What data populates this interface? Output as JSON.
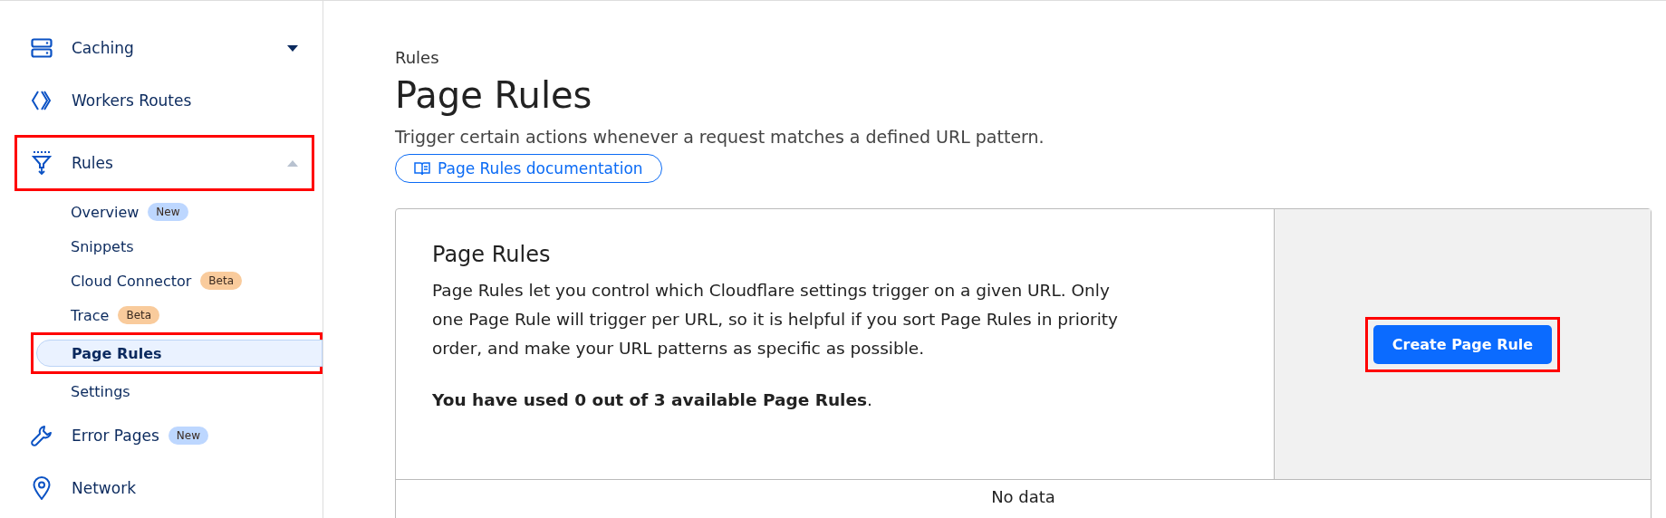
{
  "sidebar": {
    "items": [
      {
        "kind": "caching",
        "label": "Caching",
        "expanded": false,
        "highlighted": false
      },
      {
        "kind": "workers",
        "label": "Workers Routes",
        "highlighted": false
      },
      {
        "kind": "rules",
        "label": "Rules",
        "expanded": true,
        "highlighted": true,
        "children": [
          {
            "label": "Overview",
            "badge": {
              "text": "New",
              "color": "#bdd7ff"
            },
            "selected": false,
            "highlighted": false
          },
          {
            "label": "Snippets",
            "selected": false,
            "highlighted": false
          },
          {
            "label": "Cloud Connector",
            "badge": {
              "text": "Beta",
              "color": "#f9cb9c"
            },
            "selected": false,
            "highlighted": false
          },
          {
            "label": "Trace",
            "badge": {
              "text": "Beta",
              "color": "#f9cb9c"
            },
            "selected": false,
            "highlighted": false
          },
          {
            "label": "Page Rules",
            "selected": true,
            "highlighted": true
          },
          {
            "label": "Settings",
            "selected": false,
            "highlighted": false
          }
        ]
      },
      {
        "kind": "wrench",
        "label": "Error Pages",
        "badge": {
          "text": "New",
          "color": "#bdd7ff"
        },
        "highlighted": false
      },
      {
        "kind": "pin",
        "label": "Network",
        "highlighted": false
      }
    ]
  },
  "header": {
    "breadcrumb": "Rules",
    "title": "Page Rules",
    "description": "Trigger certain actions whenever a request matches a defined URL pattern.",
    "doc_link": "Page Rules documentation"
  },
  "card": {
    "title": "Page Rules",
    "text": "Page Rules let you control which Cloudflare settings trigger on a given URL. Only one Page Rule will trigger per URL, so it is helpful if you sort Page Rules in priority order, and make your URL patterns as specific as possible.",
    "usage": "**You have used 0 out of 3 available Page Rules**.",
    "button": {
      "label": "Create Page Rule",
      "highlighted": true
    },
    "empty": "No data"
  }
}
